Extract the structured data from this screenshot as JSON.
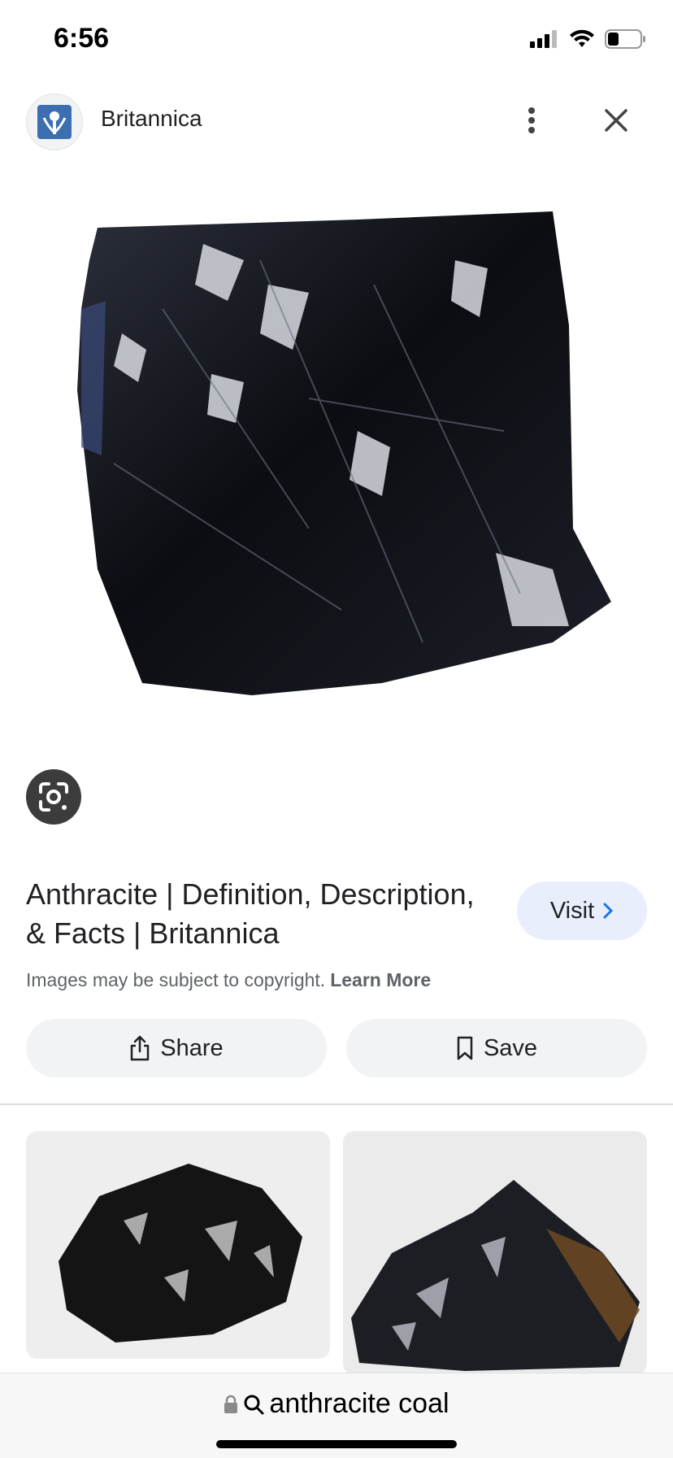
{
  "status": {
    "time": "6:56"
  },
  "header": {
    "site_name": "Britannica"
  },
  "result": {
    "title": "Anthracite | Definition, Description, & Facts | Britannica",
    "visit_label": "Visit",
    "copyright_text": "Images may be subject to copyright.",
    "learn_more": "Learn More"
  },
  "actions": {
    "share_label": "Share",
    "save_label": "Save"
  },
  "search": {
    "query": "anthracite coal"
  },
  "icons": [
    "signal-icon",
    "wifi-icon",
    "battery-icon",
    "britannica-logo",
    "more-vert-icon",
    "close-icon",
    "lens-icon",
    "chevron-right-icon",
    "share-icon",
    "bookmark-icon",
    "lock-icon",
    "search-icon"
  ],
  "colors": {
    "visit_bg": "#e8eefc",
    "button_bg": "#f1f3f4",
    "visit_chevron": "#1a73e8",
    "lens_bg": "#3c3c3c"
  }
}
